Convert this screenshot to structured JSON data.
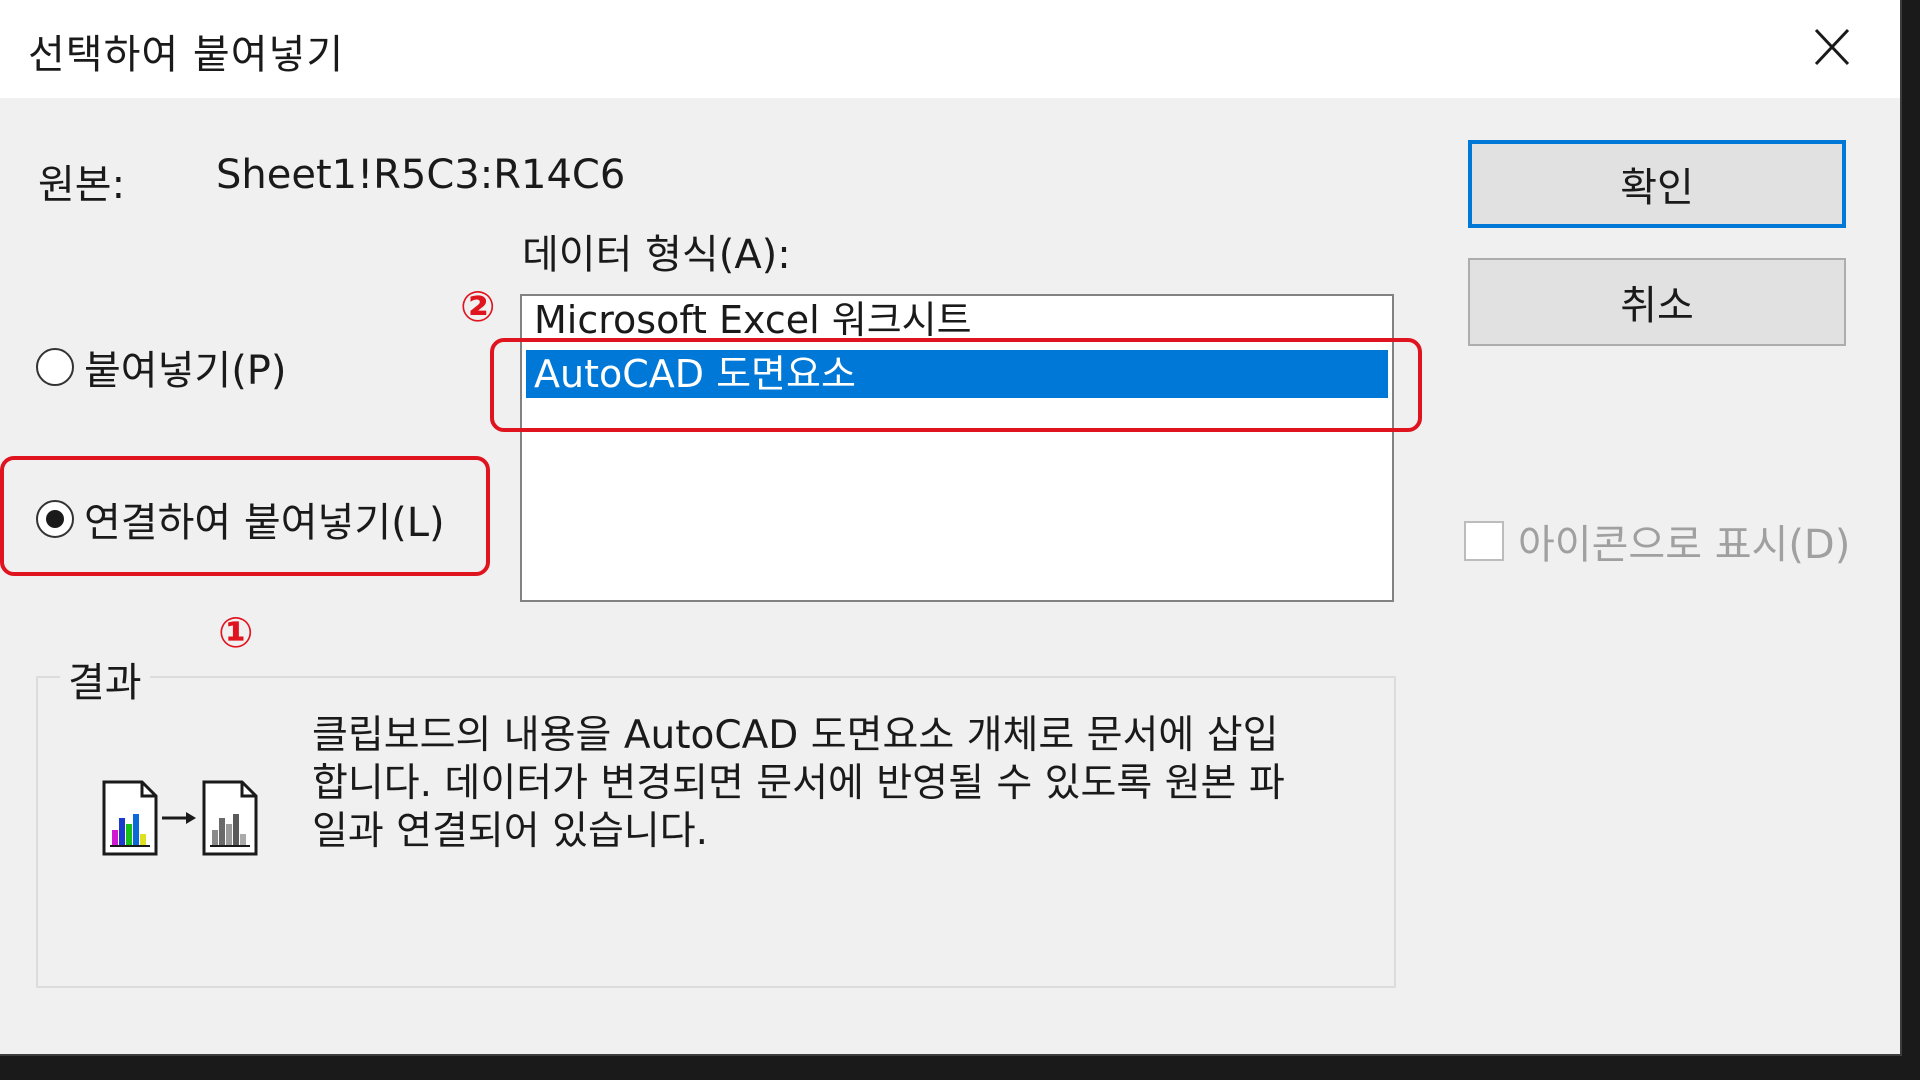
{
  "window": {
    "title": "선택하여 붙여넣기"
  },
  "source": {
    "label": "원본:",
    "value": "Sheet1!R5C3:R14C6"
  },
  "data_format": {
    "label": "데이터 형식(A):",
    "items": [
      "Microsoft Excel 워크시트",
      "AutoCAD 도면요소"
    ],
    "selected_index": 1
  },
  "options": {
    "paste": "붙여넣기(P)",
    "paste_link": "연결하여 붙여넣기(L)",
    "selected": "paste_link"
  },
  "buttons": {
    "ok": "확인",
    "cancel": "취소"
  },
  "display_as_icon": {
    "label": "아이콘으로 표시(D)",
    "checked": false,
    "enabled": false
  },
  "result": {
    "title": "결과",
    "lines": [
      "클립보드의 내용을 AutoCAD 도면요소 개체로 문서에 삽입",
      "합니다. 데이터가 변경되면 문서에 반영될 수 있도록 원본 파",
      "일과 연결되어 있습니다."
    ]
  },
  "annotations": {
    "marker_1": "①",
    "marker_2": "②",
    "color": "#e0141e"
  },
  "colors": {
    "selection": "#0078d7",
    "dialog_bg": "#f0f0f0"
  },
  "icons": {
    "close": "close-icon",
    "result": "paste-link-result-icon"
  }
}
